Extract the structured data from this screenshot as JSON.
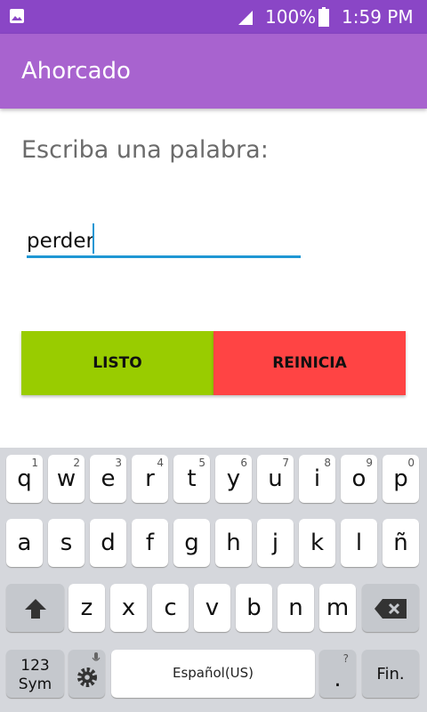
{
  "status_bar": {
    "battery_percent": "100%",
    "time": "1:59 PM",
    "icons": [
      "image-icon",
      "signal-icon",
      "battery-icon"
    ]
  },
  "app": {
    "title": "Ahorcado",
    "prompt": "Escriba una palabra:",
    "word_input_value": "perder",
    "listo_label": "LISTO",
    "reinicia_label": "REINICIA",
    "colors": {
      "status_bar": "#8a46c6",
      "app_bar": "#a863cf",
      "listo": "#99cc00",
      "reinicia": "#ff4444",
      "input_underline": "#1f97d4"
    }
  },
  "keyboard": {
    "row1": [
      {
        "k": "q",
        "h": "1"
      },
      {
        "k": "w",
        "h": "2"
      },
      {
        "k": "e",
        "h": "3"
      },
      {
        "k": "r",
        "h": "4"
      },
      {
        "k": "t",
        "h": "5"
      },
      {
        "k": "y",
        "h": "6"
      },
      {
        "k": "u",
        "h": "7"
      },
      {
        "k": "i",
        "h": "8"
      },
      {
        "k": "o",
        "h": "9"
      },
      {
        "k": "p",
        "h": "0"
      }
    ],
    "row2": [
      "a",
      "s",
      "d",
      "f",
      "g",
      "h",
      "j",
      "k",
      "l",
      "ñ"
    ],
    "row3": [
      "z",
      "x",
      "c",
      "v",
      "b",
      "n",
      "m"
    ],
    "sym_line1": "123",
    "sym_line2": "Sym",
    "space_label": "Español(US)",
    "period": ".",
    "enter_label": "Fin."
  }
}
